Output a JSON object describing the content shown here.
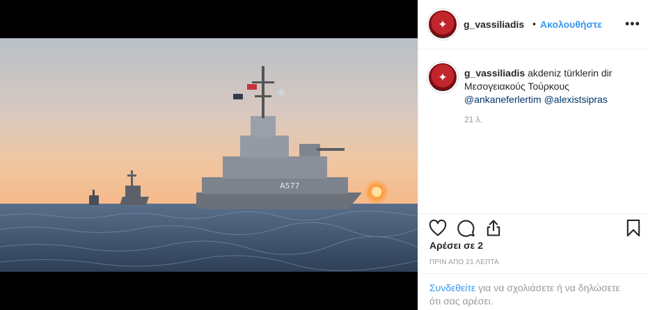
{
  "post": {
    "username": "g_vassiliadis",
    "follow_label": "Ακολουθήστε",
    "separator": "•",
    "more_label": "•••"
  },
  "caption": {
    "username": "g_vassiliadis",
    "line1": "akdeniz türklerin dir",
    "line2": "Μεσογειακούς Τούρκους",
    "mention1": "@ankaneferlertim",
    "mention2": "@alexistsipras",
    "time": "21 λ."
  },
  "photo": {
    "hull_number": "A577"
  },
  "stats": {
    "likes": "Αρέσει σε 2",
    "posted": "ΠΡΙΝ ΑΠΟ 21 ΛΕΠΤΑ"
  },
  "login": {
    "link_label": "Συνδεθείτε",
    "rest_line1": " για να σχολιάσετε ή να δηλώσετε",
    "line2": "ότι σας αρέσει."
  },
  "icons": {
    "like": "heart-icon",
    "comment": "comment-icon",
    "share": "share-icon",
    "save": "bookmark-icon",
    "avatar_emblem": "eagle-emblem-icon"
  },
  "colors": {
    "accent": "#3897f0",
    "mention": "#003569",
    "muted": "#999999",
    "text": "#262626"
  }
}
